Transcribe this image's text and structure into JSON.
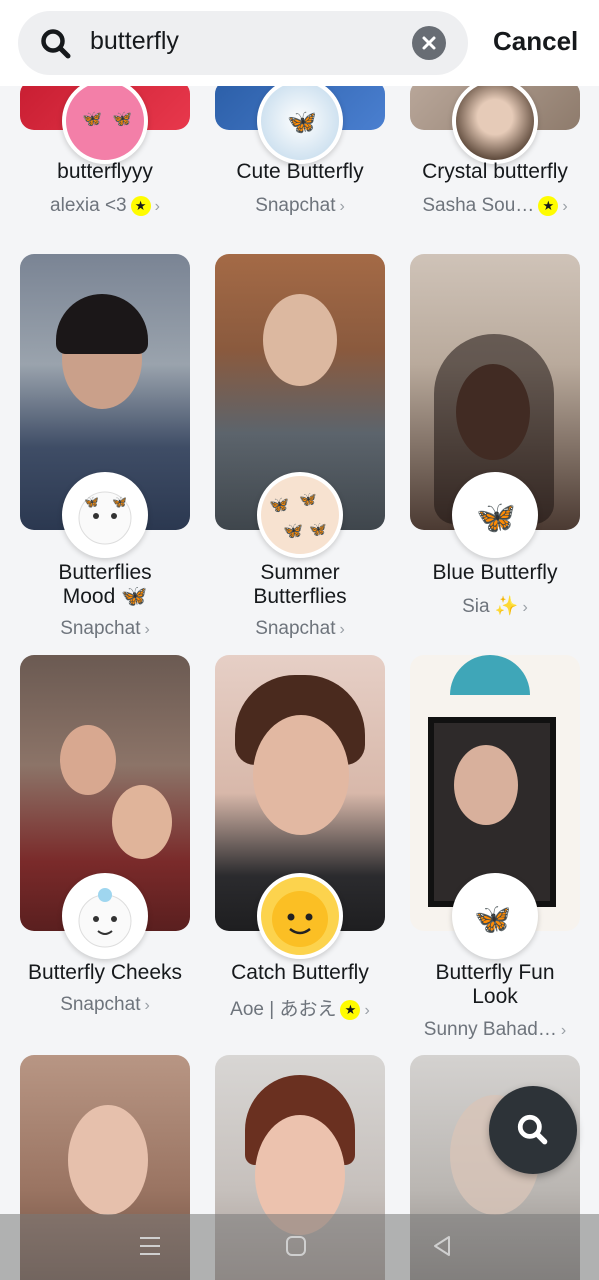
{
  "search": {
    "query": "butterfly",
    "cancel_label": "Cancel"
  },
  "lenses": [
    {
      "name": "butterflyyy",
      "creator": "alexia <3",
      "verified": true
    },
    {
      "name": "Cute Butterfly",
      "creator": "Snapchat",
      "verified": false
    },
    {
      "name": "Crystal butterfly",
      "creator": "Sasha Sou…",
      "verified": true
    },
    {
      "name": "Butterflies Mood 🦋",
      "creator": "Snapchat",
      "verified": false
    },
    {
      "name": "Summer Butterflies",
      "creator": "Snapchat",
      "verified": false
    },
    {
      "name": "Blue Butterfly",
      "creator": "Sia ✨",
      "verified": false
    },
    {
      "name": "Butterfly Cheeks",
      "creator": "Snapchat",
      "verified": false
    },
    {
      "name": "Catch Butterfly",
      "creator": "Aoe | あおえ",
      "verified": true
    },
    {
      "name": "Butterfly Fun Look",
      "creator": "Sunny Bahad…",
      "verified": false
    }
  ],
  "icons": {
    "search": "search-icon",
    "clear": "close-icon",
    "fab": "search-icon",
    "nav": [
      "menu-icon",
      "home-icon",
      "back-icon"
    ]
  },
  "colors": {
    "background": "#f4f5f7",
    "text": "#16191c",
    "muted": "#6e747c",
    "verified_star": "#fffc00",
    "fab": "#2d3338"
  }
}
